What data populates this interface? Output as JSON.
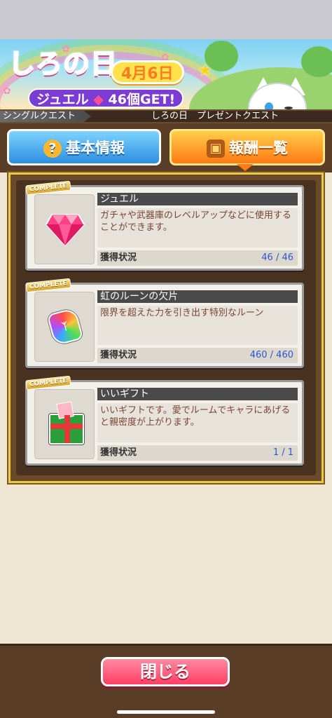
{
  "banner": {
    "title": "しろの日",
    "date": "4月6日",
    "reward_line": "ジュエル",
    "reward_count": "46個GET!"
  },
  "quest_bar": {
    "type_label": "シングルクエスト",
    "quest_name": "しろの日　プレゼントクエスト"
  },
  "tabs": {
    "basic_label": "基本情報",
    "reward_label": "報酬一覧"
  },
  "items": [
    {
      "badge": "COMPLETE",
      "name": "ジュエル",
      "description": "ガチャや武器庫のレベルアップなどに使用することができます。",
      "status_label": "獲得状況",
      "status_value": "46 / 46"
    },
    {
      "badge": "COMPLETE",
      "name": "虹のルーンの欠片",
      "description": "限界を超えた力を引き出す特別なルーン",
      "status_label": "獲得状況",
      "status_value": "460 / 460"
    },
    {
      "badge": "COMPLETE",
      "name": "いいギフト",
      "description": "いいギフトです。愛でルームでキャラにあげると親密度が上がります。",
      "status_label": "獲得状況",
      "status_value": "1 / 1"
    }
  ],
  "footer": {
    "close_label": "閉じる"
  }
}
